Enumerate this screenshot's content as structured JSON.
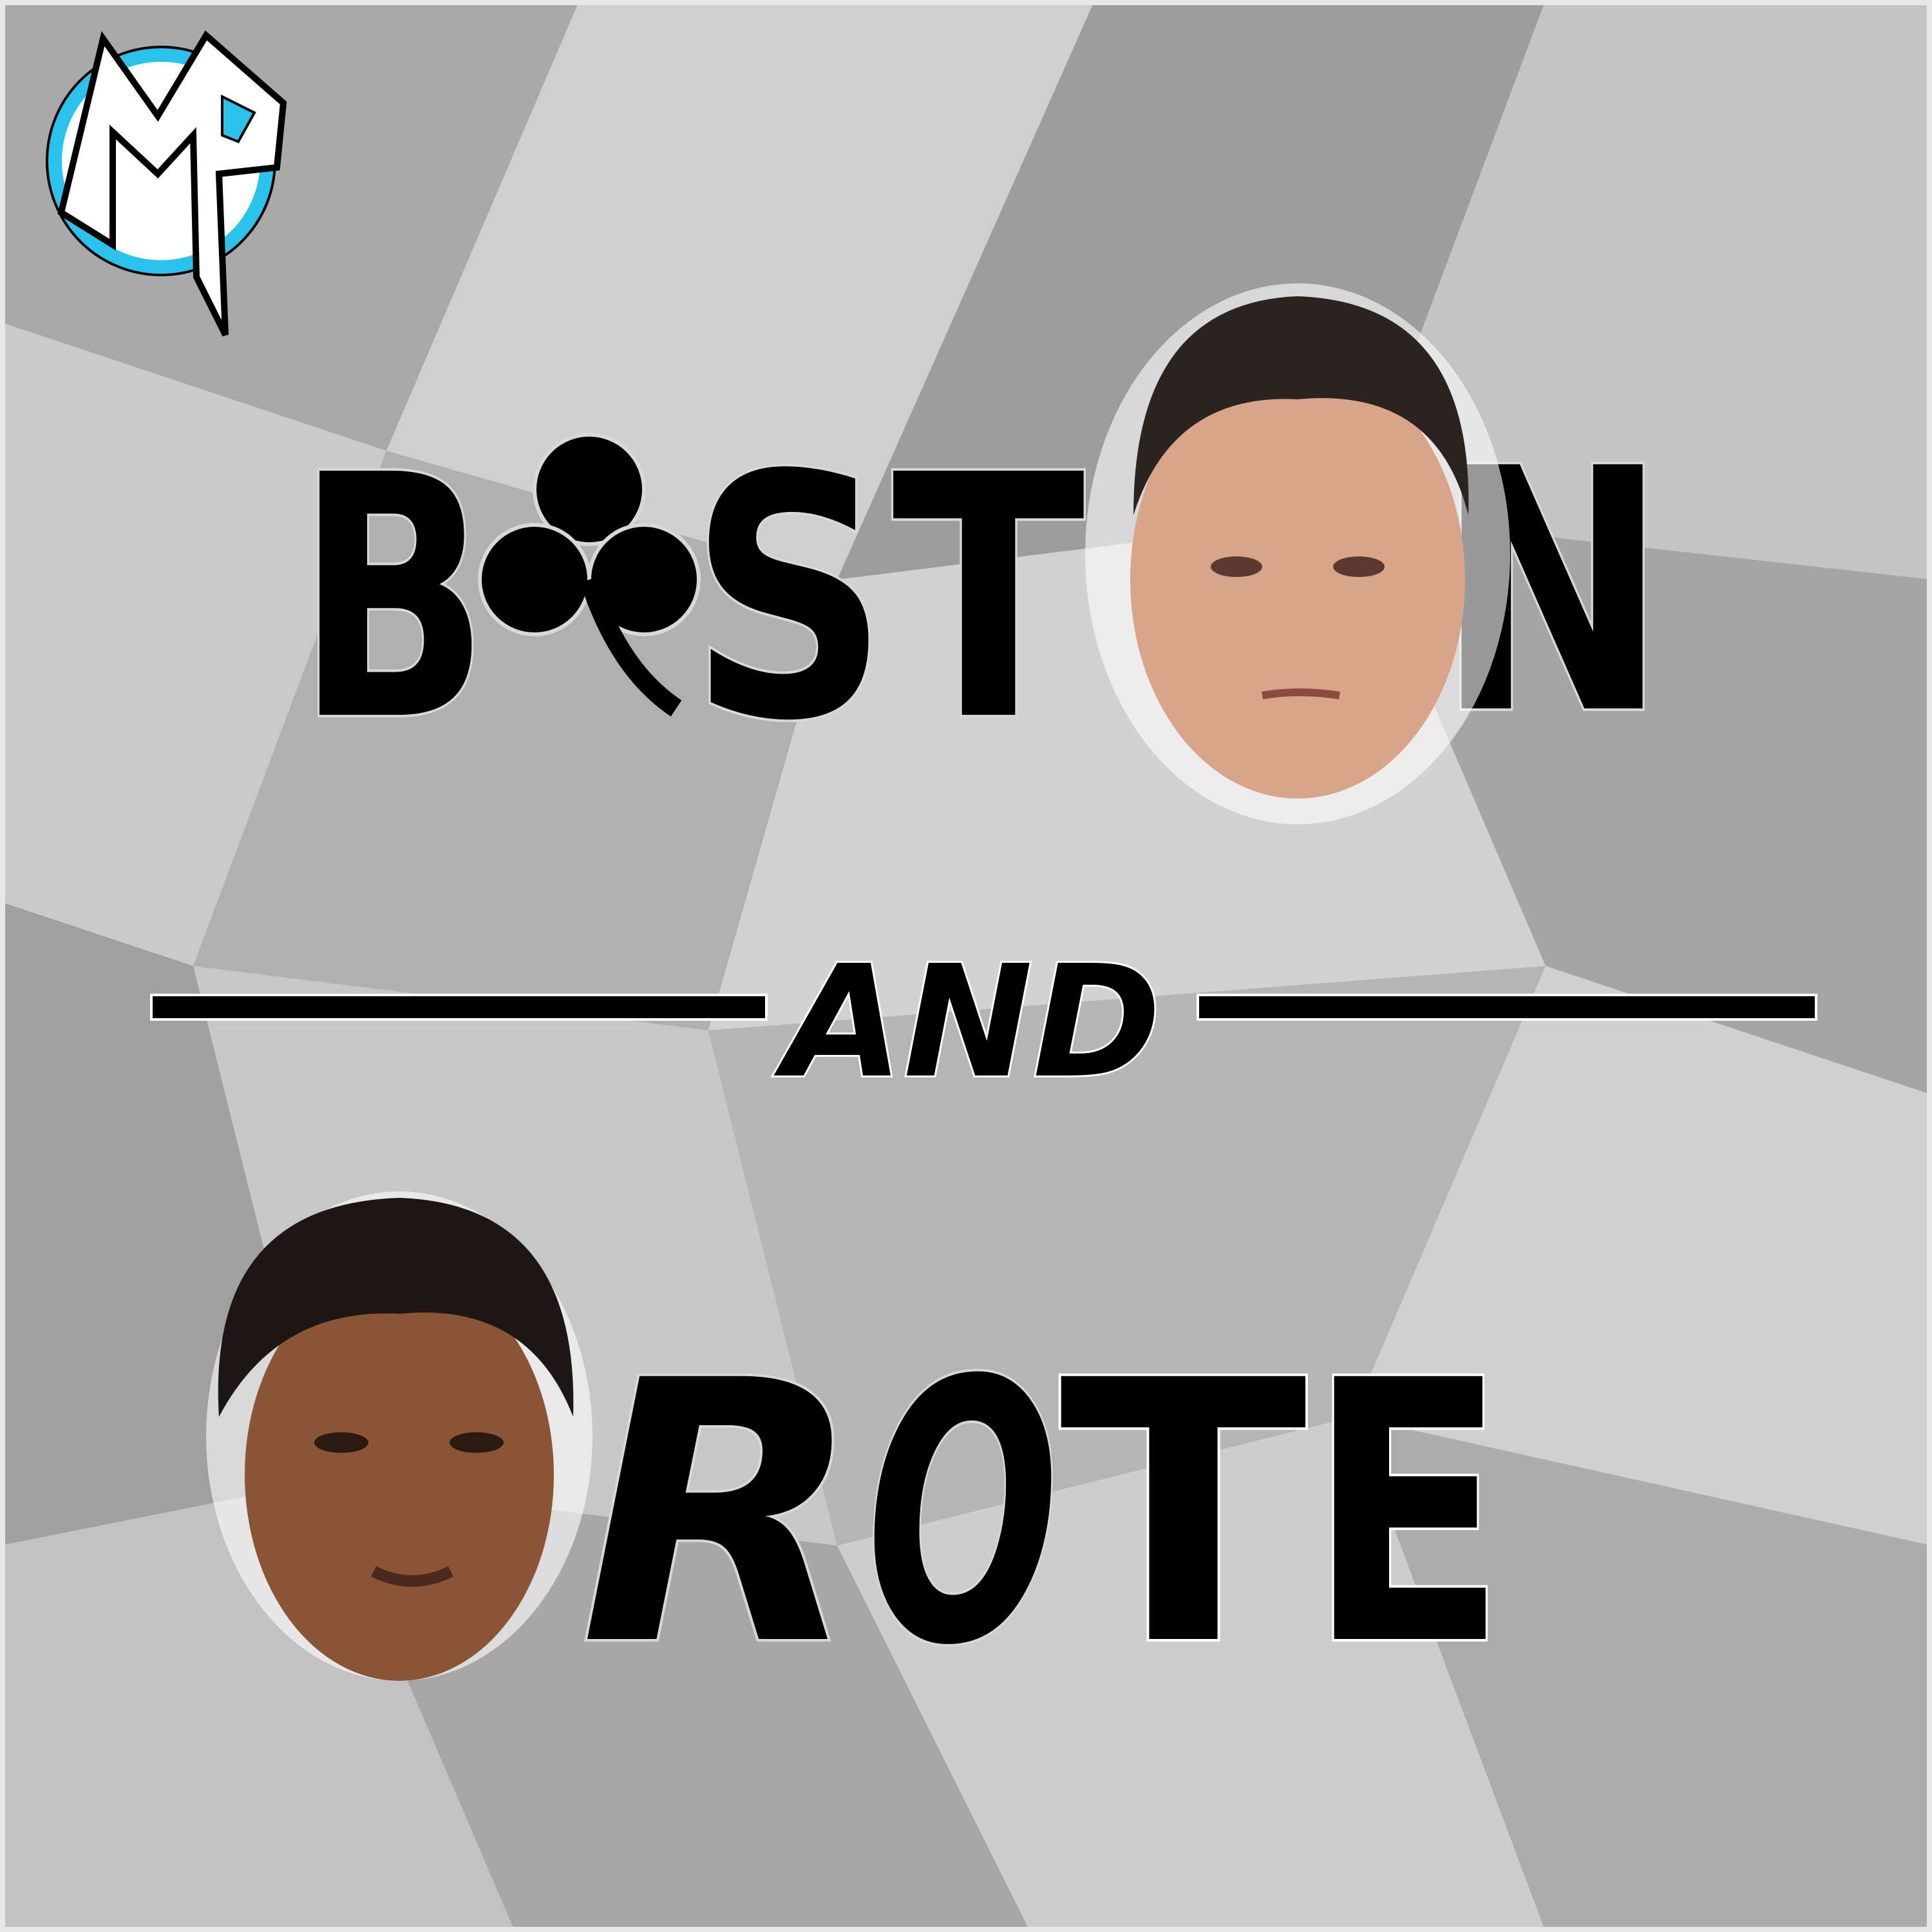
{
  "logo": {
    "text": "MP",
    "accent": "#29c3ee"
  },
  "title_top": {
    "letters": [
      "B",
      "S",
      "T",
      "N"
    ],
    "word": "BOSTON",
    "clover_icon": "shamrock-icon"
  },
  "separator": {
    "text": "AND"
  },
  "title_bottom": {
    "letters": [
      "R",
      "O",
      "T",
      "E"
    ],
    "word": "ROTE"
  },
  "colors": {
    "background": "#b8b8b8",
    "text": "#000000",
    "skin_light": "#d9a58a",
    "skin_dark": "#8a5535",
    "hair": "#2a2420"
  }
}
